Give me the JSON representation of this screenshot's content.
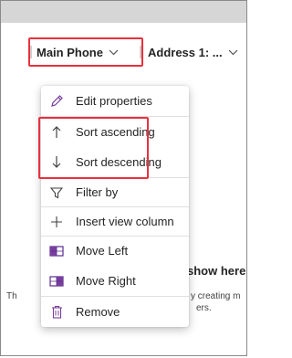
{
  "columns": {
    "main_phone": "Main Phone",
    "address": "Address 1: ..."
  },
  "background": {
    "heading_fragment": "show here",
    "line1_left": "Th",
    "line1_right": "y creating m",
    "line2_right": "ers."
  },
  "menu": {
    "edit_properties": "Edit properties",
    "sort_ascending": "Sort ascending",
    "sort_descending": "Sort descending",
    "filter_by": "Filter by",
    "insert_view_column": "Insert view column",
    "move_left": "Move Left",
    "move_right": "Move Right",
    "remove": "Remove"
  },
  "colors": {
    "highlight": "#e8313e",
    "icon_purple": "#7a3e9d",
    "topbar": "#d6d6d6"
  },
  "icons": [
    "chevron-down-icon",
    "pencil-icon",
    "arrow-up-icon",
    "arrow-down-icon",
    "filter-icon",
    "plus-icon",
    "move-left-icon",
    "move-right-icon",
    "trash-icon"
  ]
}
